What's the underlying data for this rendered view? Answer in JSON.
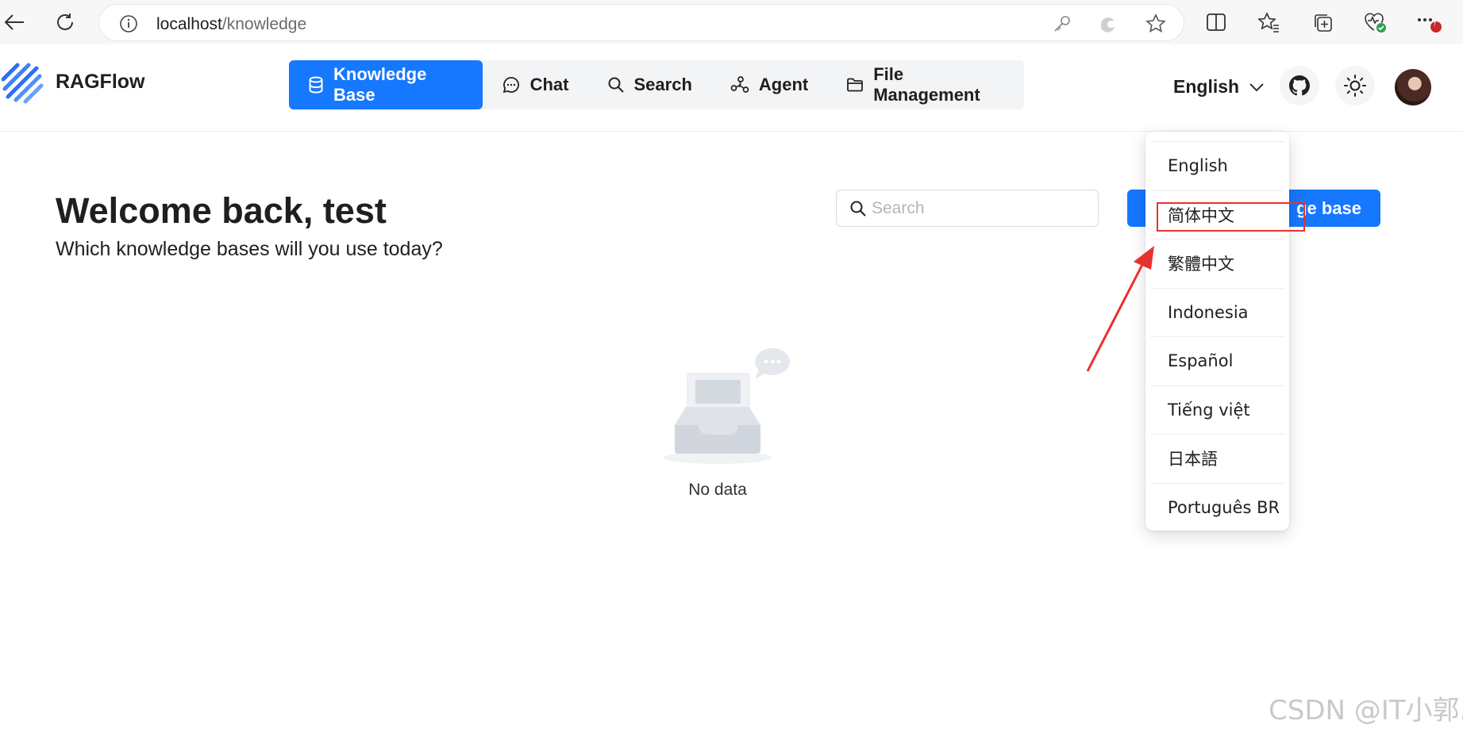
{
  "browser": {
    "url_host": "localhost",
    "url_path": "/knowledge",
    "icons": [
      "back-arrow-icon",
      "reload-icon",
      "info-icon",
      "key-icon",
      "edge-copilot-icon",
      "star-icon",
      "split-screen-icon",
      "favorites-icon",
      "collections-icon",
      "health-icon",
      "more-icon"
    ],
    "notification_badge": "↑"
  },
  "header": {
    "brand": "RAGFlow",
    "nav": [
      {
        "label": "Knowledge Base",
        "icon": "database-icon",
        "active": true
      },
      {
        "label": "Chat",
        "icon": "chat-bubble-icon",
        "active": false
      },
      {
        "label": "Search",
        "icon": "search-icon",
        "active": false
      },
      {
        "label": "Agent",
        "icon": "agent-graph-icon",
        "active": false
      },
      {
        "label": "File Management",
        "icon": "folder-icon",
        "active": false
      }
    ],
    "language": "English",
    "accent_color": "#1677ff"
  },
  "main": {
    "title": "Welcome back, test",
    "subtitle": "Which knowledge bases will you use today?",
    "search_placeholder": "Search",
    "create_button_visible": "ge base",
    "empty_text": "No data"
  },
  "language_menu": {
    "items": [
      "English",
      "简体中文",
      "繁體中文",
      "Indonesia",
      "Español",
      "Tiếng việt",
      "日本語",
      "Português BR"
    ],
    "highlighted": "简体中文",
    "annotation_color": "#e8312f"
  },
  "watermark": "CSDN @IT小郭."
}
